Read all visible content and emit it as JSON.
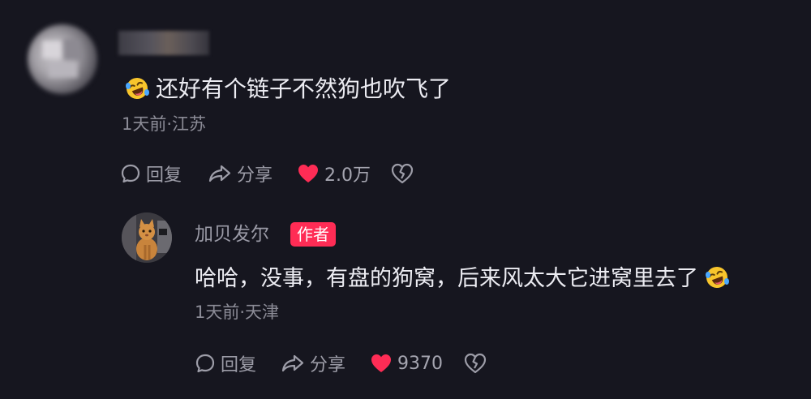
{
  "colors": {
    "background": "#16161f",
    "text_primary": "#ececf2",
    "text_secondary": "#8b8b96",
    "like_red": "#fe2c55",
    "badge_bg": "#ff2c55"
  },
  "comment": {
    "user_name": "",
    "text": "还好有个链子不然狗也吹飞了",
    "emoji": "laughing-tears-emoji",
    "meta": "1天前·江苏",
    "actions": {
      "reply_label": "回复",
      "share_label": "分享",
      "like_count": "2.0万"
    }
  },
  "reply": {
    "user_name": "加贝发尔",
    "badge": "作者",
    "text": "哈哈，没事，有盘的狗窝，后来风太大它进窝里去了",
    "emoji": "laughing-tears-emoji",
    "meta": "1天前·天津",
    "actions": {
      "reply_label": "回复",
      "share_label": "分享",
      "like_count": "9370"
    }
  },
  "icons": {
    "reply": "speech-bubble-icon",
    "share": "share-arrow-icon",
    "like": "heart-icon",
    "dislike": "broken-heart-icon"
  }
}
